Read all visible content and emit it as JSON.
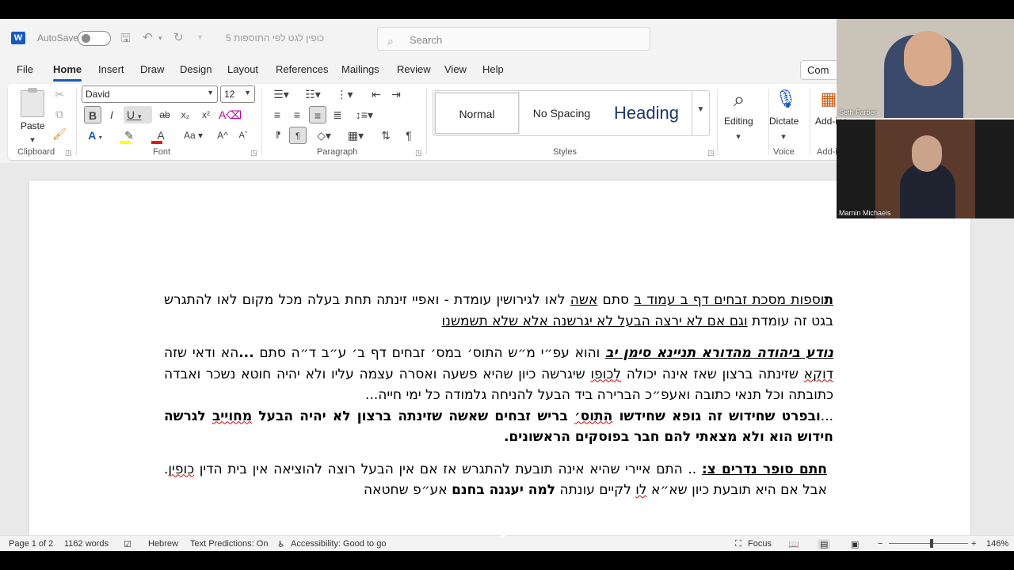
{
  "titlebar": {
    "app_icon": "word-logo-icon",
    "autosave_label": "AutoSave",
    "autosave_on": false,
    "doc_title": "5 כופין לגט לפי התוספות",
    "search_placeholder": "Search"
  },
  "tabs": [
    "File",
    "Home",
    "Insert",
    "Draw",
    "Design",
    "Layout",
    "References",
    "Mailings",
    "Review",
    "View",
    "Help"
  ],
  "active_tab": "Home",
  "comments_label": "Com",
  "ribbon": {
    "clipboard": {
      "label": "Clipboard",
      "paste_label": "Paste"
    },
    "font": {
      "label": "Font",
      "font_name": "David",
      "font_size": "12",
      "case_label": "Aa"
    },
    "paragraph": {
      "label": "Paragraph"
    },
    "styles": {
      "label": "Styles",
      "items": [
        "Normal",
        "No Spacing",
        "Heading"
      ]
    },
    "editing": {
      "label": "Editing"
    },
    "voice": {
      "label": "Voice",
      "dictate_label": "Dictate"
    },
    "addins": {
      "label": "Add-i",
      "button_label": "Add-ins"
    }
  },
  "document": {
    "para1": {
      "first_char": "ת",
      "rest": "וספות מסכת זבחים דף ב עמוד ב",
      "text2": " סתם ",
      "text3": "אשה",
      "text4": " לאו לגירושין עומדת - ואפיי זינתה תחת בעלה מכל מקום לאו להתגרש בגט זה עומדת ",
      "text5": "וגם אם לא ירצה הבעל לא יגרשנה אלא שלא תשמשנו"
    },
    "para2": {
      "heading": "נודע ביהודה מהדורא תניינא סימן יב",
      "text1": "  והוא עפ״י מ״ש התוס׳ במס׳ זבחים דף ב׳ ע״ב ד״ה סתם ",
      "bold_dots": "...",
      "text2": "הא ודאי שזה ",
      "word_dokka": "דוקא",
      "text3": " שזינתה ברצון שאז אינה יכולה ",
      "word_lkofo": "לכופו",
      "text4": " שיגרשה כיון שהיא פשעה ואסרה עצמה עליו ולא יהיה חוטא נשכר ואבדה כתובתה וכל תנאי כתובה ואעפ״כ הברירה ביד הבעל להניחה גלמודה כל ימי חייה..."
    },
    "para3": {
      "lead": "...",
      "text1": "ובפרט שחידוש זה גופא שחידשו ",
      "word_tos": "התוס׳",
      "text2": " בריש זבחים שאשה שזינתה ברצון לא יהיה הבעל ",
      "word_mechuyav": "מחוייב",
      "text3": " לגרשה חידוש הוא ולא מצאתי להם חבר בפוסקים הראשונים."
    },
    "para4": {
      "heading": "חתם סופר נדרים צ:",
      "text1": " .. התם איירי שהיא אינה תובעת להתגרש אז אם אין הבעל רוצה להוציאה אין בית הדין ",
      "word_kofin": "כופין",
      "text2": ". אבל אם היא תובעת כיון שא״א ",
      "word_li": "לו",
      "text3": " לקיים עונתה ",
      "bold_text": "למה יעגנה בחנם",
      "text4": " אע״פ שחטאה"
    }
  },
  "statusbar": {
    "page": "Page 1 of 2",
    "words": "1162 words",
    "language": "Hebrew",
    "predictions": "Text Predictions: On",
    "accessibility": "Accessibility: Good to go",
    "focus": "Focus",
    "zoom": "146%"
  },
  "video": {
    "participant1": "Seth Farber",
    "participant2": "Marnin Michaels"
  }
}
